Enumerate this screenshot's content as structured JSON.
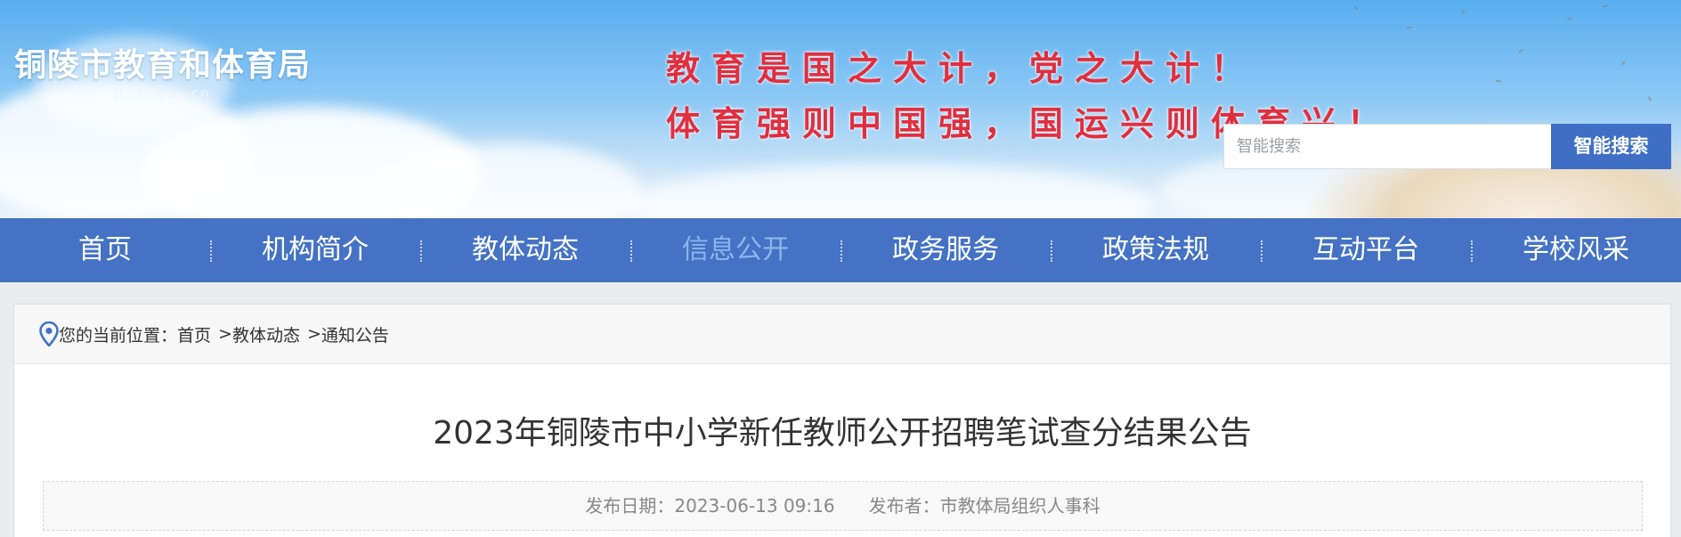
{
  "header": {
    "site_title": "铜陵市教育和体育局",
    "site_domain": "jtj.tl.gov.cn",
    "slogan_line1": "教育是国之大计，党之大计！",
    "slogan_line2": "体育强则中国强，国运兴则体育兴！",
    "search_placeholder": "智能搜索",
    "search_button": "智能搜索"
  },
  "nav": {
    "items": [
      {
        "label": "首页"
      },
      {
        "label": "机构简介"
      },
      {
        "label": "教体动态"
      },
      {
        "label": "信息公开"
      },
      {
        "label": "政务服务"
      },
      {
        "label": "政策法规"
      },
      {
        "label": "互动平台"
      },
      {
        "label": "学校风采"
      }
    ],
    "active": "信息公开"
  },
  "breadcrumb": {
    "prefix": "您的当前位置：",
    "items": [
      "首页",
      "教体动态",
      "通知公告"
    ],
    "separator": ">"
  },
  "article": {
    "title": "2023年铜陵市中小学新任教师公开招聘笔试查分结果公告",
    "publish_date": "发布日期：2023-06-13 09:16",
    "publisher": "发布者：市教体局组织人事科"
  },
  "colors": {
    "nav_bg": "#4572c4",
    "nav_active": "#8ab6ec",
    "slogan": "#e02f3f",
    "search_button": "#3f6fc4"
  },
  "icons": {
    "breadcrumb": "location-pin-icon"
  }
}
